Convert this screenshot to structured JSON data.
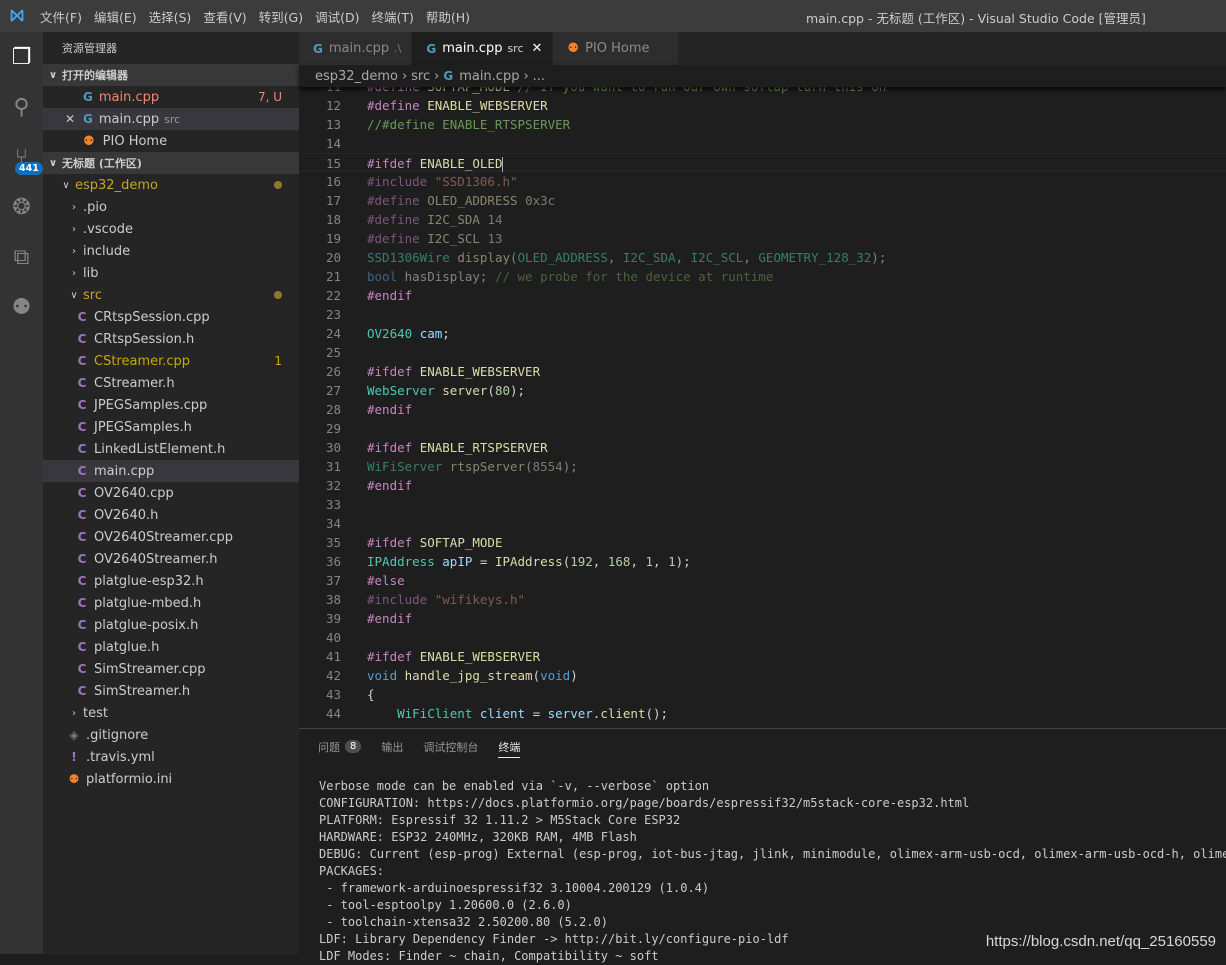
{
  "window_title": "main.cpp - 无标题 (工作区) - Visual Studio Code [管理员]",
  "menu": [
    "文件(F)",
    "编辑(E)",
    "选择(S)",
    "查看(V)",
    "转到(G)",
    "调试(D)",
    "终端(T)",
    "帮助(H)"
  ],
  "activity": {
    "scm_badge": "441"
  },
  "sidebar": {
    "title": "资源管理器",
    "open_editors_label": "打开的编辑器",
    "open_editors": [
      {
        "name": "main.cpp",
        "sub": "",
        "deco": "7, U",
        "color": "#f48771"
      },
      {
        "name": "main.cpp",
        "sub": "src",
        "deco": "",
        "color": "#cccccc"
      },
      {
        "name": "PIO Home",
        "sub": "",
        "deco": "",
        "color": "#cccccc"
      }
    ],
    "workspace_label": "无标题 (工作区)",
    "root": "esp32_demo",
    "folders": [
      ".pio",
      ".vscode",
      "include",
      "lib"
    ],
    "src_folder": "src",
    "src_files": [
      {
        "name": "CRtspSession.cpp",
        "deco": ""
      },
      {
        "name": "CRtspSession.h",
        "deco": ""
      },
      {
        "name": "CStreamer.cpp",
        "deco": "1",
        "warn": true
      },
      {
        "name": "CStreamer.h",
        "deco": ""
      },
      {
        "name": "JPEGSamples.cpp",
        "deco": ""
      },
      {
        "name": "JPEGSamples.h",
        "deco": ""
      },
      {
        "name": "LinkedListElement.h",
        "deco": ""
      },
      {
        "name": "main.cpp",
        "deco": "",
        "selected": true
      },
      {
        "name": "OV2640.cpp",
        "deco": ""
      },
      {
        "name": "OV2640.h",
        "deco": ""
      },
      {
        "name": "OV2640Streamer.cpp",
        "deco": ""
      },
      {
        "name": "OV2640Streamer.h",
        "deco": ""
      },
      {
        "name": "platglue-esp32.h",
        "deco": ""
      },
      {
        "name": "platglue-mbed.h",
        "deco": ""
      },
      {
        "name": "platglue-posix.h",
        "deco": ""
      },
      {
        "name": "platglue.h",
        "deco": ""
      },
      {
        "name": "SimStreamer.cpp",
        "deco": ""
      },
      {
        "name": "SimStreamer.h",
        "deco": ""
      }
    ],
    "test_folder": "test",
    "root_files": [
      ".gitignore",
      ".travis.yml",
      "platformio.ini"
    ]
  },
  "tabs": [
    {
      "name": "main.cpp",
      "sub": ".\\"
    },
    {
      "name": "main.cpp",
      "sub": "src",
      "close": "✕"
    },
    {
      "name": "PIO Home",
      "sub": ""
    }
  ],
  "breadcrumb": [
    "esp32_demo",
    "src",
    "main.cpp",
    "..."
  ],
  "code": [
    {
      "n": "11",
      "t": [
        [
          "#define ",
          "pp"
        ],
        [
          "SOFTAP_MODE ",
          "mac"
        ],
        [
          "// If you want to run our own softap turn this on",
          "cm"
        ]
      ]
    },
    {
      "n": "12",
      "t": [
        [
          "#define ",
          "pp"
        ],
        [
          "ENABLE_WEBSERVER",
          "mac"
        ]
      ]
    },
    {
      "n": "13",
      "t": [
        [
          "//#define ENABLE_RTSPSERVER",
          "cm"
        ]
      ]
    },
    {
      "n": "14",
      "t": []
    },
    {
      "n": "15",
      "cur": true,
      "t": [
        [
          "#ifdef ",
          "pp"
        ],
        [
          "ENABLE_OLED",
          "mac"
        ]
      ]
    },
    {
      "n": "16",
      "dim": true,
      "t": [
        [
          "#include ",
          "pp"
        ],
        [
          "\"SSD1306.h\"",
          "str"
        ]
      ]
    },
    {
      "n": "17",
      "dim": true,
      "t": [
        [
          "#define ",
          "pp"
        ],
        [
          "OLED_ADDRESS ",
          "mac"
        ],
        [
          "0x3c",
          "nm"
        ]
      ]
    },
    {
      "n": "18",
      "dim": true,
      "t": [
        [
          "#define ",
          "pp"
        ],
        [
          "I2C_SDA ",
          "mac"
        ],
        [
          "14",
          "nm"
        ]
      ]
    },
    {
      "n": "19",
      "dim": true,
      "t": [
        [
          "#define ",
          "pp"
        ],
        [
          "I2C_SCL ",
          "mac"
        ],
        [
          "13",
          "nm"
        ]
      ]
    },
    {
      "n": "20",
      "dim": true,
      "t": [
        [
          "SSD1306Wire ",
          "ty"
        ],
        [
          "display",
          "fn"
        ],
        [
          "(",
          "tx"
        ],
        [
          "OLED_ADDRESS",
          "ty"
        ],
        [
          ", ",
          "tx"
        ],
        [
          "I2C_SDA",
          "ty"
        ],
        [
          ", ",
          "tx"
        ],
        [
          "I2C_SCL",
          "ty"
        ],
        [
          ", ",
          "tx"
        ],
        [
          "GEOMETRY_128_32",
          "ty"
        ],
        [
          ");",
          "tx"
        ]
      ]
    },
    {
      "n": "21",
      "dim": true,
      "t": [
        [
          "bool ",
          "kw"
        ],
        [
          "hasDisplay; ",
          "tx"
        ],
        [
          "// we probe for the device at runtime",
          "cm"
        ]
      ]
    },
    {
      "n": "22",
      "t": [
        [
          "#endif",
          "pp"
        ]
      ]
    },
    {
      "n": "23",
      "t": []
    },
    {
      "n": "24",
      "t": [
        [
          "OV2640 ",
          "ty"
        ],
        [
          "cam",
          "vr"
        ],
        [
          ";",
          "tx"
        ]
      ]
    },
    {
      "n": "25",
      "t": []
    },
    {
      "n": "26",
      "t": [
        [
          "#ifdef ",
          "pp"
        ],
        [
          "ENABLE_WEBSERVER",
          "mac"
        ]
      ]
    },
    {
      "n": "27",
      "t": [
        [
          "WebServer ",
          "ty"
        ],
        [
          "server",
          "fn"
        ],
        [
          "(",
          "tx"
        ],
        [
          "80",
          "nm"
        ],
        [
          ");",
          "tx"
        ]
      ]
    },
    {
      "n": "28",
      "t": [
        [
          "#endif",
          "pp"
        ]
      ]
    },
    {
      "n": "29",
      "t": []
    },
    {
      "n": "30",
      "t": [
        [
          "#ifdef ",
          "pp"
        ],
        [
          "ENABLE_RTSPSERVER",
          "mac"
        ]
      ]
    },
    {
      "n": "31",
      "dim": true,
      "t": [
        [
          "WiFiServer ",
          "ty"
        ],
        [
          "rtspServer",
          "fn"
        ],
        [
          "(",
          "tx"
        ],
        [
          "8554",
          "nm"
        ],
        [
          ");",
          "tx"
        ]
      ]
    },
    {
      "n": "32",
      "t": [
        [
          "#endif",
          "pp"
        ]
      ]
    },
    {
      "n": "33",
      "t": []
    },
    {
      "n": "34",
      "t": []
    },
    {
      "n": "35",
      "t": [
        [
          "#ifdef ",
          "pp"
        ],
        [
          "SOFTAP_MODE",
          "mac"
        ]
      ]
    },
    {
      "n": "36",
      "t": [
        [
          "IPAddress ",
          "ty"
        ],
        [
          "apIP",
          "vr"
        ],
        [
          " = ",
          "tx"
        ],
        [
          "IPAddress",
          "fn"
        ],
        [
          "(",
          "tx"
        ],
        [
          "192",
          "nm"
        ],
        [
          ", ",
          "tx"
        ],
        [
          "168",
          "nm"
        ],
        [
          ", ",
          "tx"
        ],
        [
          "1",
          "nm"
        ],
        [
          ", ",
          "tx"
        ],
        [
          "1",
          "nm"
        ],
        [
          ");",
          "tx"
        ]
      ]
    },
    {
      "n": "37",
      "t": [
        [
          "#else",
          "pp"
        ]
      ]
    },
    {
      "n": "38",
      "dim": true,
      "t": [
        [
          "#include ",
          "pp"
        ],
        [
          "\"wifikeys.h\"",
          "str"
        ]
      ]
    },
    {
      "n": "39",
      "t": [
        [
          "#endif",
          "pp"
        ]
      ]
    },
    {
      "n": "40",
      "t": []
    },
    {
      "n": "41",
      "t": [
        [
          "#ifdef ",
          "pp"
        ],
        [
          "ENABLE_WEBSERVER",
          "mac"
        ]
      ]
    },
    {
      "n": "42",
      "t": [
        [
          "void ",
          "kw"
        ],
        [
          "handle_jpg_stream",
          "fn"
        ],
        [
          "(",
          "tx"
        ],
        [
          "void",
          "kw"
        ],
        [
          ")",
          "tx"
        ]
      ]
    },
    {
      "n": "43",
      "t": [
        [
          "{",
          "tx"
        ]
      ]
    },
    {
      "n": "44",
      "t": [
        [
          "    WiFiClient ",
          "ty"
        ],
        [
          "client",
          "vr"
        ],
        [
          " = ",
          "tx"
        ],
        [
          "server",
          "vr"
        ],
        [
          ".",
          "tx"
        ],
        [
          "client",
          "fn"
        ],
        [
          "();",
          "tx"
        ]
      ]
    }
  ],
  "panel": {
    "tabs": [
      "问题",
      "输出",
      "调试控制台",
      "终端"
    ],
    "problems_count": "8",
    "terminal": [
      "Verbose mode can be enabled via `-v, --verbose` option",
      "CONFIGURATION: https://docs.platformio.org/page/boards/espressif32/m5stack-core-esp32.html",
      "PLATFORM: Espressif 32 1.11.2 > M5Stack Core ESP32",
      "HARDWARE: ESP32 240MHz, 320KB RAM, 4MB Flash",
      "DEBUG: Current (esp-prog) External (esp-prog, iot-bus-jtag, jlink, minimodule, olimex-arm-usb-ocd, olimex-arm-usb-ocd-h, olimex-arm",
      "PACKAGES:",
      " - framework-arduinoespressif32 3.10004.200129 (1.0.4)",
      " - tool-esptoolpy 1.20600.0 (2.6.0)",
      " - toolchain-xtensa32 2.50200.80 (5.2.0)",
      "LDF: Library Dependency Finder -> http://bit.ly/configure-pio-ldf",
      "LDF Modes: Finder ~ chain, Compatibility ~ soft"
    ]
  },
  "watermark": "https://blog.csdn.net/qq_25160559"
}
